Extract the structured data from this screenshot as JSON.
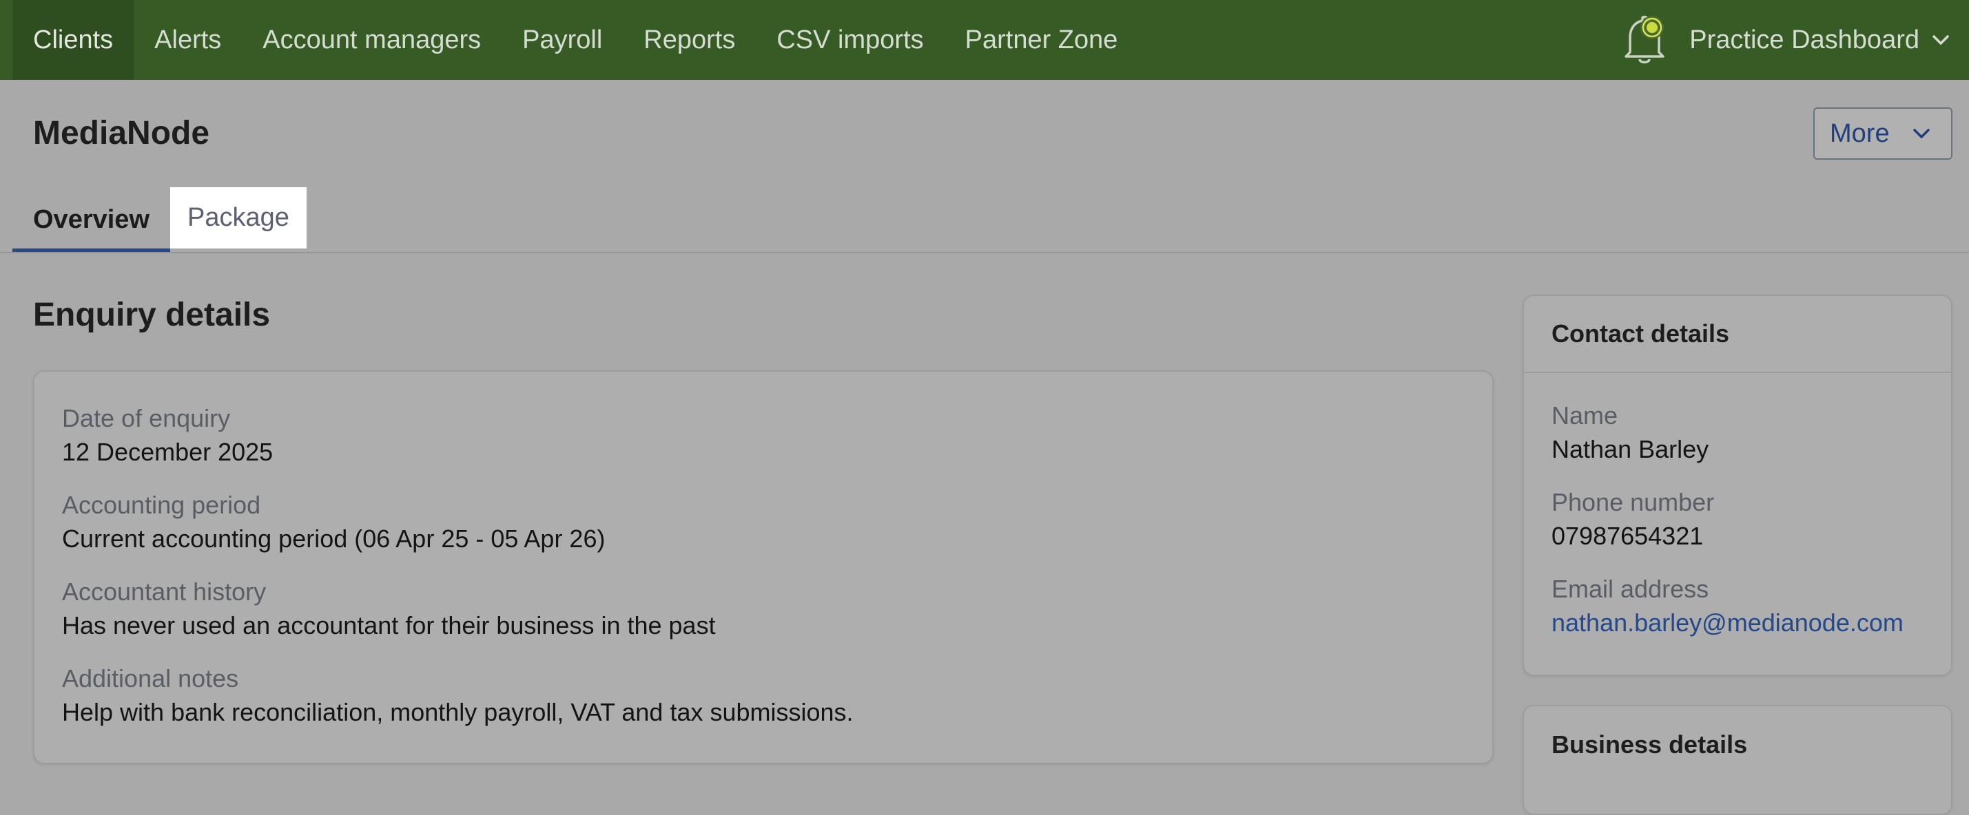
{
  "nav": {
    "items": [
      {
        "label": "Clients",
        "active": true
      },
      {
        "label": "Alerts",
        "active": false
      },
      {
        "label": "Account managers",
        "active": false
      },
      {
        "label": "Payroll",
        "active": false
      },
      {
        "label": "Reports",
        "active": false
      },
      {
        "label": "CSV imports",
        "active": false
      },
      {
        "label": "Partner Zone",
        "active": false
      }
    ],
    "practice_label": "Practice Dashboard",
    "icons": {
      "notifications": "bell-icon",
      "dropdown": "chevron-down-icon"
    }
  },
  "header": {
    "title": "MediaNode",
    "more_label": "More"
  },
  "tabs": [
    {
      "label": "Overview",
      "selected": true
    },
    {
      "label": "Package",
      "selected": false
    }
  ],
  "enquiry": {
    "title": "Enquiry details",
    "fields": [
      {
        "label": "Date of enquiry",
        "value": "12 December 2025"
      },
      {
        "label": "Accounting period",
        "value": "Current accounting period (06 Apr 25 - 05 Apr 26)"
      },
      {
        "label": "Accountant history",
        "value": "Has never used an accountant for their business in the past"
      },
      {
        "label": "Additional notes",
        "value": "Help with bank reconciliation, monthly payroll, VAT and tax submissions."
      }
    ]
  },
  "contact": {
    "title": "Contact details",
    "name_label": "Name",
    "name": "Nathan Barley",
    "phone_label": "Phone number",
    "phone": "07987654321",
    "email_label": "Email address",
    "email": "nathan.barley@medianode.com"
  },
  "business": {
    "title": "Business details"
  },
  "colors": {
    "nav_bg": "#365b25",
    "accent_blue": "#24498a",
    "overlay_bg": "#a9a9a9",
    "bell_indicator": "#b8d13a"
  }
}
